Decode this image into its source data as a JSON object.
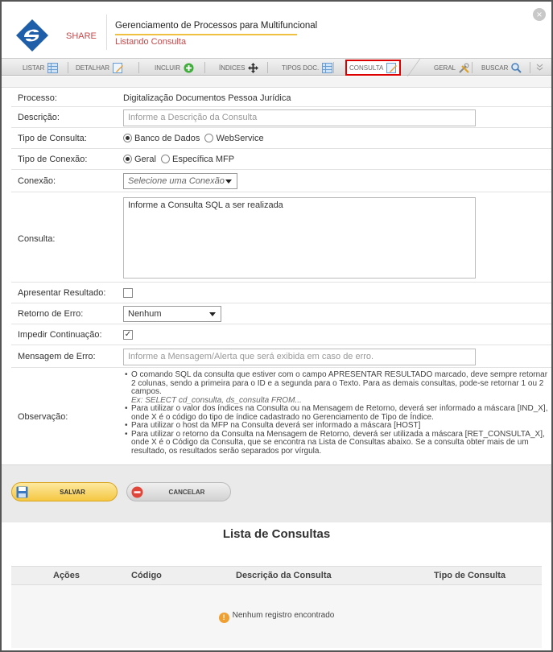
{
  "header": {
    "brand": "SHARE",
    "title": "Gerenciamento de Processos para Multifuncional",
    "subtitle": "Listando Consulta",
    "close_symbol": "×",
    "colors": {
      "brand_red": "#c8484a",
      "accent_yellow": "#f0c040"
    }
  },
  "tabs": [
    {
      "label": "LISTAR",
      "icon": "grid-icon"
    },
    {
      "label": "DETALHAR",
      "icon": "edit-icon"
    },
    {
      "label": "INCLUIR",
      "icon": "add-circle-icon"
    },
    {
      "label": "ÍNDICES",
      "icon": "move-arrows-icon"
    },
    {
      "label": "TIPOS DOC.",
      "icon": "grid-icon"
    },
    {
      "label": "CONSULTA",
      "icon": "edit-icon",
      "active": true
    },
    {
      "label": "GERAL",
      "icon": "tools-icon"
    },
    {
      "label": "BUSCAR",
      "icon": "search-icon"
    }
  ],
  "form": {
    "processo": {
      "label": "Processo:",
      "value": "Digitalização Documentos Pessoa Jurídica"
    },
    "descricao": {
      "label": "Descrição:",
      "placeholder": "Informe a Descrição da Consulta"
    },
    "tipo_consulta": {
      "label": "Tipo de Consulta:",
      "options": [
        "Banco de Dados",
        "WebService"
      ],
      "selected": "Banco de Dados"
    },
    "tipo_conexao": {
      "label": "Tipo de Conexão:",
      "options": [
        "Geral",
        "Específica MFP"
      ],
      "selected": "Geral"
    },
    "conexao": {
      "label": "Conexão:",
      "value": "Selecione uma Conexão"
    },
    "consulta": {
      "label": "Consulta:",
      "placeholder": "Informe a Consulta SQL a ser realizada"
    },
    "apresentar_resultado": {
      "label": "Apresentar Resultado:",
      "checked": false
    },
    "retorno_erro": {
      "label": "Retorno de Erro:",
      "value": "Nenhum"
    },
    "impedir_continuacao": {
      "label": "Impedir Continuação:",
      "checked": true,
      "check_mark": "✓"
    },
    "mensagem_erro": {
      "label": "Mensagem de Erro:",
      "placeholder": "Informe a Mensagem/Alerta que será exibida em caso de erro."
    },
    "observacao": {
      "label": "Observação:",
      "items": [
        "O comando SQL da consulta que estiver com o campo APRESENTAR RESULTADO marcado, deve sempre retornar 2 colunas, sendo a primeira para o ID e a segunda para o Texto. Para as demais consultas, pode-se retornar 1 ou 2 campos.",
        "Para utilizar o valor dos índices na Consulta ou na Mensagem de Retorno, deverá ser informado a máscara [IND_X], onde X é o código do tipo de índice cadastrado no Gerenciamento de Tipo de Índice.",
        "Para utilizar o host da MFP na Consulta deverá ser informado a máscara [HOST]",
        "Para utilizar o retorno da Consulta na Mensagem de Retorno, deverá ser utilizada a máscara [RET_CONSULTA_X], onde X é o Código da Consulta, que se encontra na Lista de Consultas abaixo. Se a consulta obter mais de um resultado, os resultados serão separados por vírgula."
      ],
      "example": "Ex: SELECT cd_consulta, ds_consulta FROM..."
    }
  },
  "actions": {
    "save": "SALVAR",
    "cancel": "CANCELAR"
  },
  "list": {
    "title": "Lista de Consultas",
    "columns": [
      "Ações",
      "Código",
      "Descrição da Consulta",
      "Tipo de Consulta"
    ],
    "empty_icon": "!",
    "empty_message": "Nenhum registro encontrado"
  }
}
